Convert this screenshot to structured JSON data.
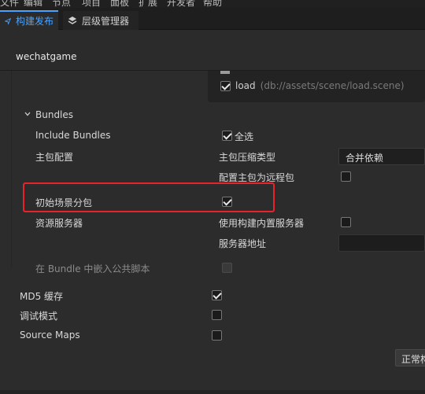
{
  "menu": [
    "文件",
    "编辑",
    "节点",
    "项目",
    "面板",
    "扩展",
    "开发者",
    "帮助"
  ],
  "tabs": [
    {
      "label": "构建发布",
      "icon": "send-icon",
      "active": true
    },
    {
      "label": "层级管理器",
      "icon": "layers-icon",
      "active": false
    }
  ],
  "platform_title": "wechatgame",
  "scene": {
    "name": "load",
    "path": "(db://assets/scene/load.scene)",
    "checked": true
  },
  "bundles": {
    "section_label": "Bundles",
    "include_label": "Include Bundles",
    "select_all_label": "全选",
    "select_all_checked": true,
    "main_config_label": "主包配置",
    "compression_label": "主包压缩类型",
    "compression_value": "合并依赖",
    "remote_label": "配置主包为远程包",
    "remote_checked": false,
    "initial_scene_label": "初始场景分包",
    "initial_scene_checked": true,
    "resource_server_label": "资源服务器",
    "builtin_server_label": "使用构建内置服务器",
    "builtin_server_checked": false,
    "server_address_label": "服务器地址",
    "server_address_value": "",
    "embed_label": "在 Bundle 中嵌入公共脚本"
  },
  "options": {
    "md5_label": "MD5 缓存",
    "md5_checked": true,
    "debug_label": "调试模式",
    "debug_checked": false,
    "sourcemaps_label": "Source Maps",
    "sourcemaps_checked": false
  },
  "build_mode_button": "正常构建",
  "colors": {
    "accent": "#4aa3ff",
    "highlight": "#e8232b",
    "background": "#2b2b2b"
  }
}
